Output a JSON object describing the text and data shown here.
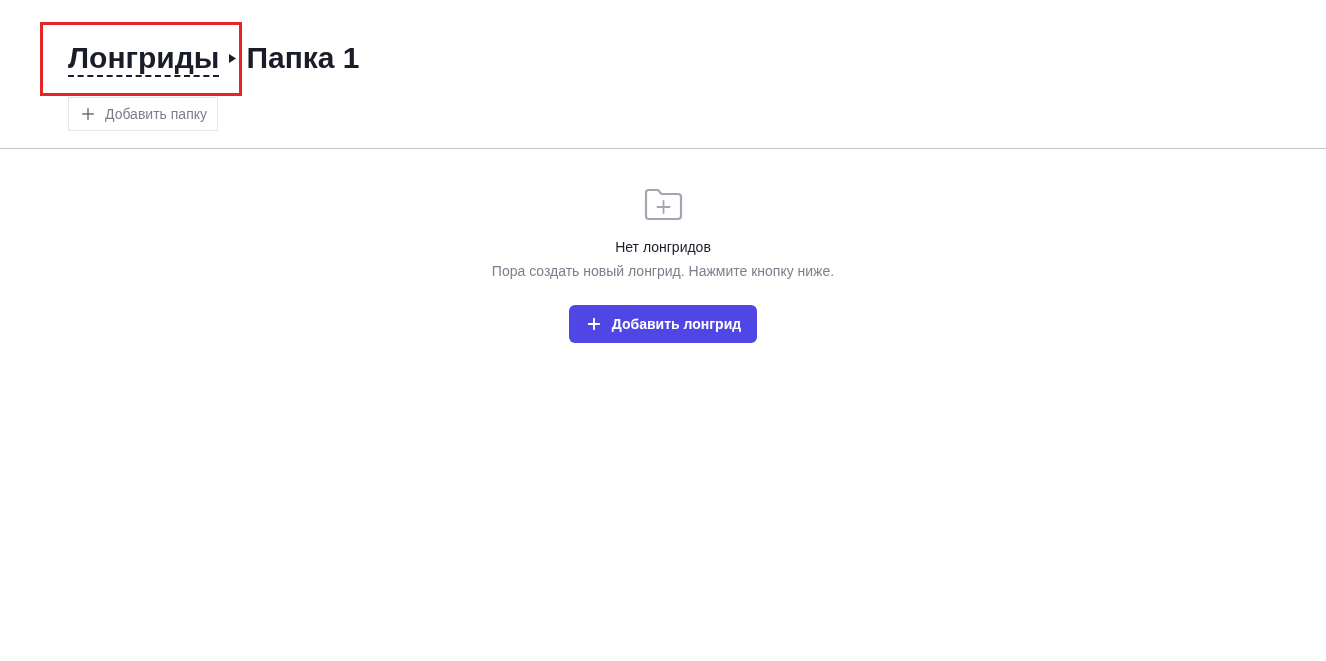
{
  "breadcrumb": [
    {
      "label": "Лонгриды",
      "kind": "link",
      "highlighted": true
    },
    {
      "label": "Папка 1",
      "kind": "current",
      "highlighted": false
    }
  ],
  "add_folder_button": {
    "label": "Добавить папку"
  },
  "empty_state": {
    "title": "Нет лонгридов",
    "message": "Пора создать новый лонгрид. Нажмите кнопку ниже.",
    "button": {
      "label": "Добавить лонгрид"
    }
  }
}
